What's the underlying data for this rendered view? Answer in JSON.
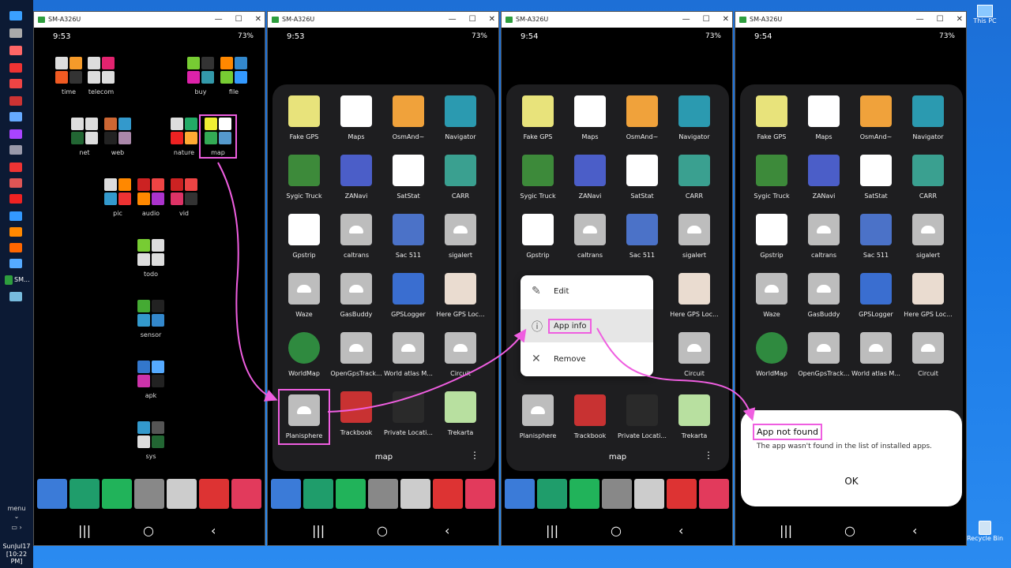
{
  "taskbar": {
    "menu_label": "menu",
    "active_item": "SM...",
    "clock_date": "SunJul17",
    "clock_time": "[10:22 PM]"
  },
  "desktop": {
    "this_pc": "This PC",
    "recycle_bin": "Recycle Bin"
  },
  "windows": [
    {
      "title": "SM-A326U",
      "time": "9:53",
      "status": "73%"
    },
    {
      "title": "SM-A326U",
      "time": "9:53",
      "status": "73%"
    },
    {
      "title": "SM-A326U",
      "time": "9:54",
      "status": "73%"
    },
    {
      "title": "SM-A326U",
      "time": "9:54",
      "status": "73%"
    }
  ],
  "home_folders": [
    "time",
    "telecom",
    "buy",
    "file",
    "net",
    "web",
    "nature",
    "map",
    "pic",
    "audio",
    "vid",
    "todo",
    "sensor",
    "apk",
    "sys"
  ],
  "folder": {
    "name": "map",
    "apps": [
      "Fake GPS",
      "Maps",
      "OsmAnd~",
      "Navigator",
      "Sygic Truck",
      "ZANavi",
      "SatStat",
      "CARR",
      "Gpstrip",
      "caltrans",
      "Sac 511",
      "sigalert",
      "Waze",
      "GasBuddy",
      "GPSLogger",
      "Here GPS Loc...",
      "WorldMap",
      "OpenGpsTrack...",
      "World atlas M...",
      "Circuit",
      "Planisphere",
      "Trackbook",
      "Private Locati...",
      "Trekarta"
    ]
  },
  "context_menu": {
    "edit": "Edit",
    "app_info": "App info",
    "remove": "Remove"
  },
  "dialog": {
    "title": "App not found",
    "body": "The app wasn't found in the list of installed apps.",
    "ok": "OK"
  },
  "colors": {
    "highlight": "#ef5ee0",
    "desktop": "#1979e6"
  }
}
